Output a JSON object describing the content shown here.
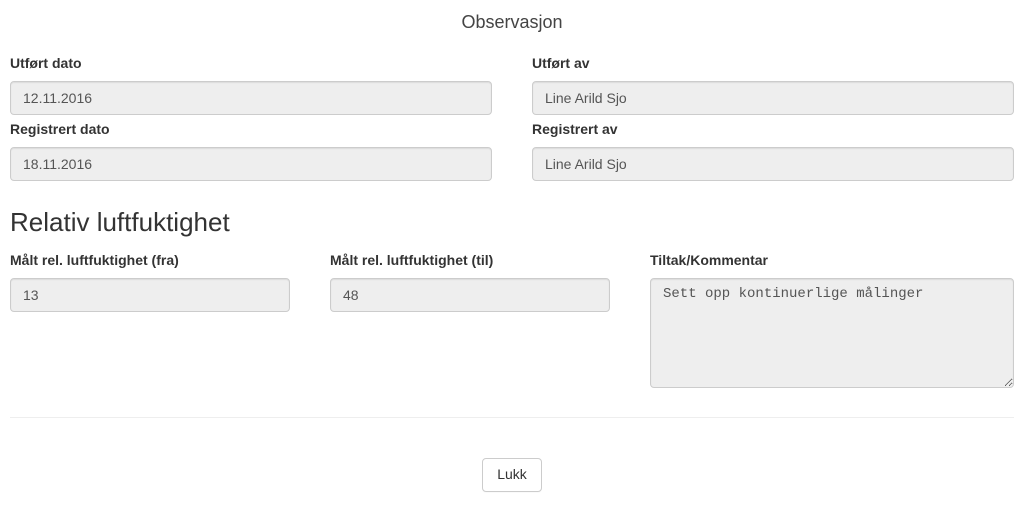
{
  "title": "Observasjon",
  "performed": {
    "date_label": "Utført dato",
    "date_value": "12.11.2016",
    "by_label": "Utført av",
    "by_value": "Line Arild Sjo"
  },
  "registered": {
    "date_label": "Registrert dato",
    "date_value": "18.11.2016",
    "by_label": "Registrert av",
    "by_value": "Line Arild Sjo"
  },
  "section_humidity_title": "Relativ luftfuktighet",
  "humidity": {
    "from_label": "Målt rel. luftfuktighet (fra)",
    "from_value": "13",
    "to_label": "Målt rel. luftfuktighet (til)",
    "to_value": "48",
    "comment_label": "Tiltak/Kommentar",
    "comment_value": "Sett opp kontinuerlige målinger"
  },
  "actions": {
    "close_label": "Lukk"
  }
}
